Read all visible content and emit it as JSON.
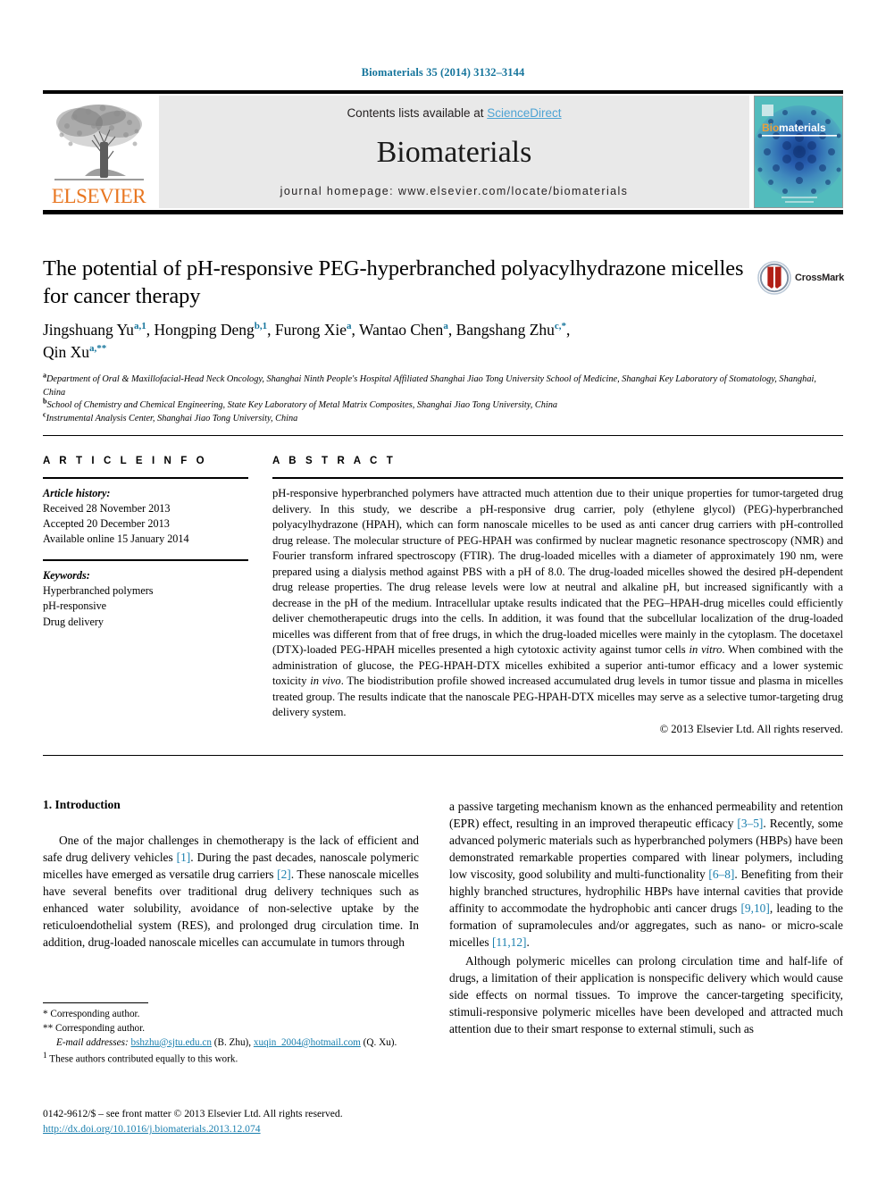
{
  "running_head": "Biomaterials 35 (2014) 3132–3144",
  "masthead": {
    "contents_prefix": "Contents lists available at ",
    "sciencedirect": "ScienceDirect",
    "journal_name": "Biomaterials",
    "homepage": "journal homepage: www.elsevier.com/locate/biomaterials",
    "publisher_wordmark": "ELSEVIER",
    "cover_title_prefix": "Bio",
    "cover_title_suffix": "materials"
  },
  "article": {
    "title": "The potential of pH-responsive PEG-hyperbranched polyacylhydrazone micelles for cancer therapy",
    "crossmark_label": "CrossMark",
    "authors_line1_parts": [
      {
        "name": "Jingshuang Yu",
        "sup": "a,1"
      },
      {
        "name": ", Hongping Deng",
        "sup": "b,1"
      },
      {
        "name": ", Furong Xie",
        "sup": "a"
      },
      {
        "name": ", Wantao Chen",
        "sup": "a"
      },
      {
        "name": ", Bangshang Zhu",
        "sup": "c,*"
      },
      {
        "name": ",",
        "sup": ""
      }
    ],
    "authors_line2_parts": [
      {
        "name": "Qin Xu",
        "sup": "a,**"
      }
    ],
    "affiliations": [
      {
        "marker": "a",
        "text": "Department of Oral & Maxillofacial-Head Neck Oncology, Shanghai Ninth People's Hospital Affiliated Shanghai Jiao Tong University School of Medicine, Shanghai Key Laboratory of Stomatology, Shanghai, China"
      },
      {
        "marker": "b",
        "text": "School of Chemistry and Chemical Engineering, State Key Laboratory of Metal Matrix Composites, Shanghai Jiao Tong University, China"
      },
      {
        "marker": "c",
        "text": "Instrumental Analysis Center, Shanghai Jiao Tong University, China"
      }
    ]
  },
  "article_info": {
    "heading": "A R T I C L E    I N F O",
    "history_label": "Article history:",
    "history": [
      "Received 28 November 2013",
      "Accepted 20 December 2013",
      "Available online 15 January 2014"
    ],
    "keywords_label": "Keywords:",
    "keywords": [
      "Hyperbranched polymers",
      "pH-responsive",
      "Drug delivery"
    ]
  },
  "abstract": {
    "heading": "A B S T R A C T",
    "body_part1": "pH-responsive hyperbranched polymers have attracted much attention due to their unique properties for tumor-targeted drug delivery. In this study, we describe a pH-responsive drug carrier, poly (ethylene glycol) (PEG)-hyperbranched polyacylhydrazone (HPAH), which can form nanoscale micelles to be used as anti cancer drug carriers with pH-controlled drug release. The molecular structure of PEG-HPAH was confirmed by nuclear magnetic resonance spectroscopy (NMR) and Fourier transform infrared spectroscopy (FTIR). The drug-loaded micelles with a diameter of approximately 190 nm, were prepared using a dialysis method against PBS with a pH of 8.0. The drug-loaded micelles showed the desired pH-dependent drug release properties. The drug release levels were low at neutral and alkaline pH, but increased significantly with a decrease in the pH of the medium. Intracellular uptake results indicated that the PEG–HPAH-drug micelles could efficiently deliver chemotherapeutic drugs into the cells. In addition, it was found that the subcellular localization of the drug-loaded micelles was different from that of free drugs, in which the drug-loaded micelles were mainly in the cytoplasm. The docetaxel (DTX)-loaded PEG-HPAH micelles presented a high cytotoxic activity against tumor cells ",
    "italic1": "in vitro",
    "body_part2": ". When combined with the administration of glucose, the PEG-HPAH-DTX micelles exhibited a superior anti-tumor efficacy and a lower systemic toxicity ",
    "italic2": "in vivo",
    "body_part3": ". The biodistribution profile showed increased accumulated drug levels in tumor tissue and plasma in micelles treated group. The results indicate that the nanoscale PEG-HPAH-DTX micelles may serve as a selective tumor-targeting drug delivery system.",
    "copyright": "© 2013 Elsevier Ltd. All rights reserved."
  },
  "body": {
    "section_heading": "1. Introduction",
    "left_paragraph_parts": [
      "One of the major challenges in chemotherapy is the lack of efficient and safe drug delivery vehicles ",
      "[1]",
      ". During the past decades, nanoscale polymeric micelles have emerged as versatile drug carriers ",
      "[2]",
      ". These nanoscale micelles have several benefits over traditional drug delivery techniques such as enhanced water solubility, avoidance of non-selective uptake by the reticuloendothelial system (RES), and prolonged drug circulation time. In addition, drug-loaded nanoscale micelles can accumulate in tumors through"
    ],
    "right_paragraph1_parts": [
      "a passive targeting mechanism known as the enhanced permeability and retention (EPR) effect, resulting in an improved therapeutic efficacy ",
      "[3–5]",
      ". Recently, some advanced polymeric materials such as hyperbranched polymers (HBPs) have been demonstrated remarkable properties compared with linear polymers, including low viscosity, good solubility and multi-functionality ",
      "[6–8]",
      ". Benefiting from their highly branched structures, hydrophilic HBPs have internal cavities that provide affinity to accommodate the hydrophobic anti cancer drugs ",
      "[9,10]",
      ", leading to the formation of supramolecules and/or aggregates, such as nano- or micro-scale micelles ",
      "[11,12]",
      "."
    ],
    "right_paragraph2": "Although polymeric micelles can prolong circulation time and half-life of drugs, a limitation of their application is nonspecific delivery which would cause side effects on normal tissues. To improve the cancer-targeting specificity, stimuli-responsive polymeric micelles have been developed and attracted much attention due to their smart response to external stimuli, such as"
  },
  "footnotes": {
    "star1": "* Corresponding author.",
    "star2": "** Corresponding author.",
    "email_label": "E-mail addresses:",
    "email1": "bshzhu@sjtu.edu.cn",
    "email1_owner": "(B. Zhu),",
    "email2": "xuqin_2004@hotmail.com",
    "email2_owner": "(Q. Xu).",
    "equal_contrib_marker": "1",
    "equal_contrib": "These authors contributed equally to this work."
  },
  "footer": {
    "issn_line": "0142-9612/$ – see front matter © 2013 Elsevier Ltd. All rights reserved.",
    "doi": "http://dx.doi.org/10.1016/j.biomaterials.2013.12.074"
  },
  "colors": {
    "link_teal": "#16759c",
    "link_blue": "#1a7fae",
    "sciencedirect_blue": "#4da3d4",
    "elsevier_orange": "#e87722",
    "masthead_gray": "#e9e9e9",
    "cover_teal": "#3fb0b5",
    "cover_blue": "#1b4f9c"
  }
}
